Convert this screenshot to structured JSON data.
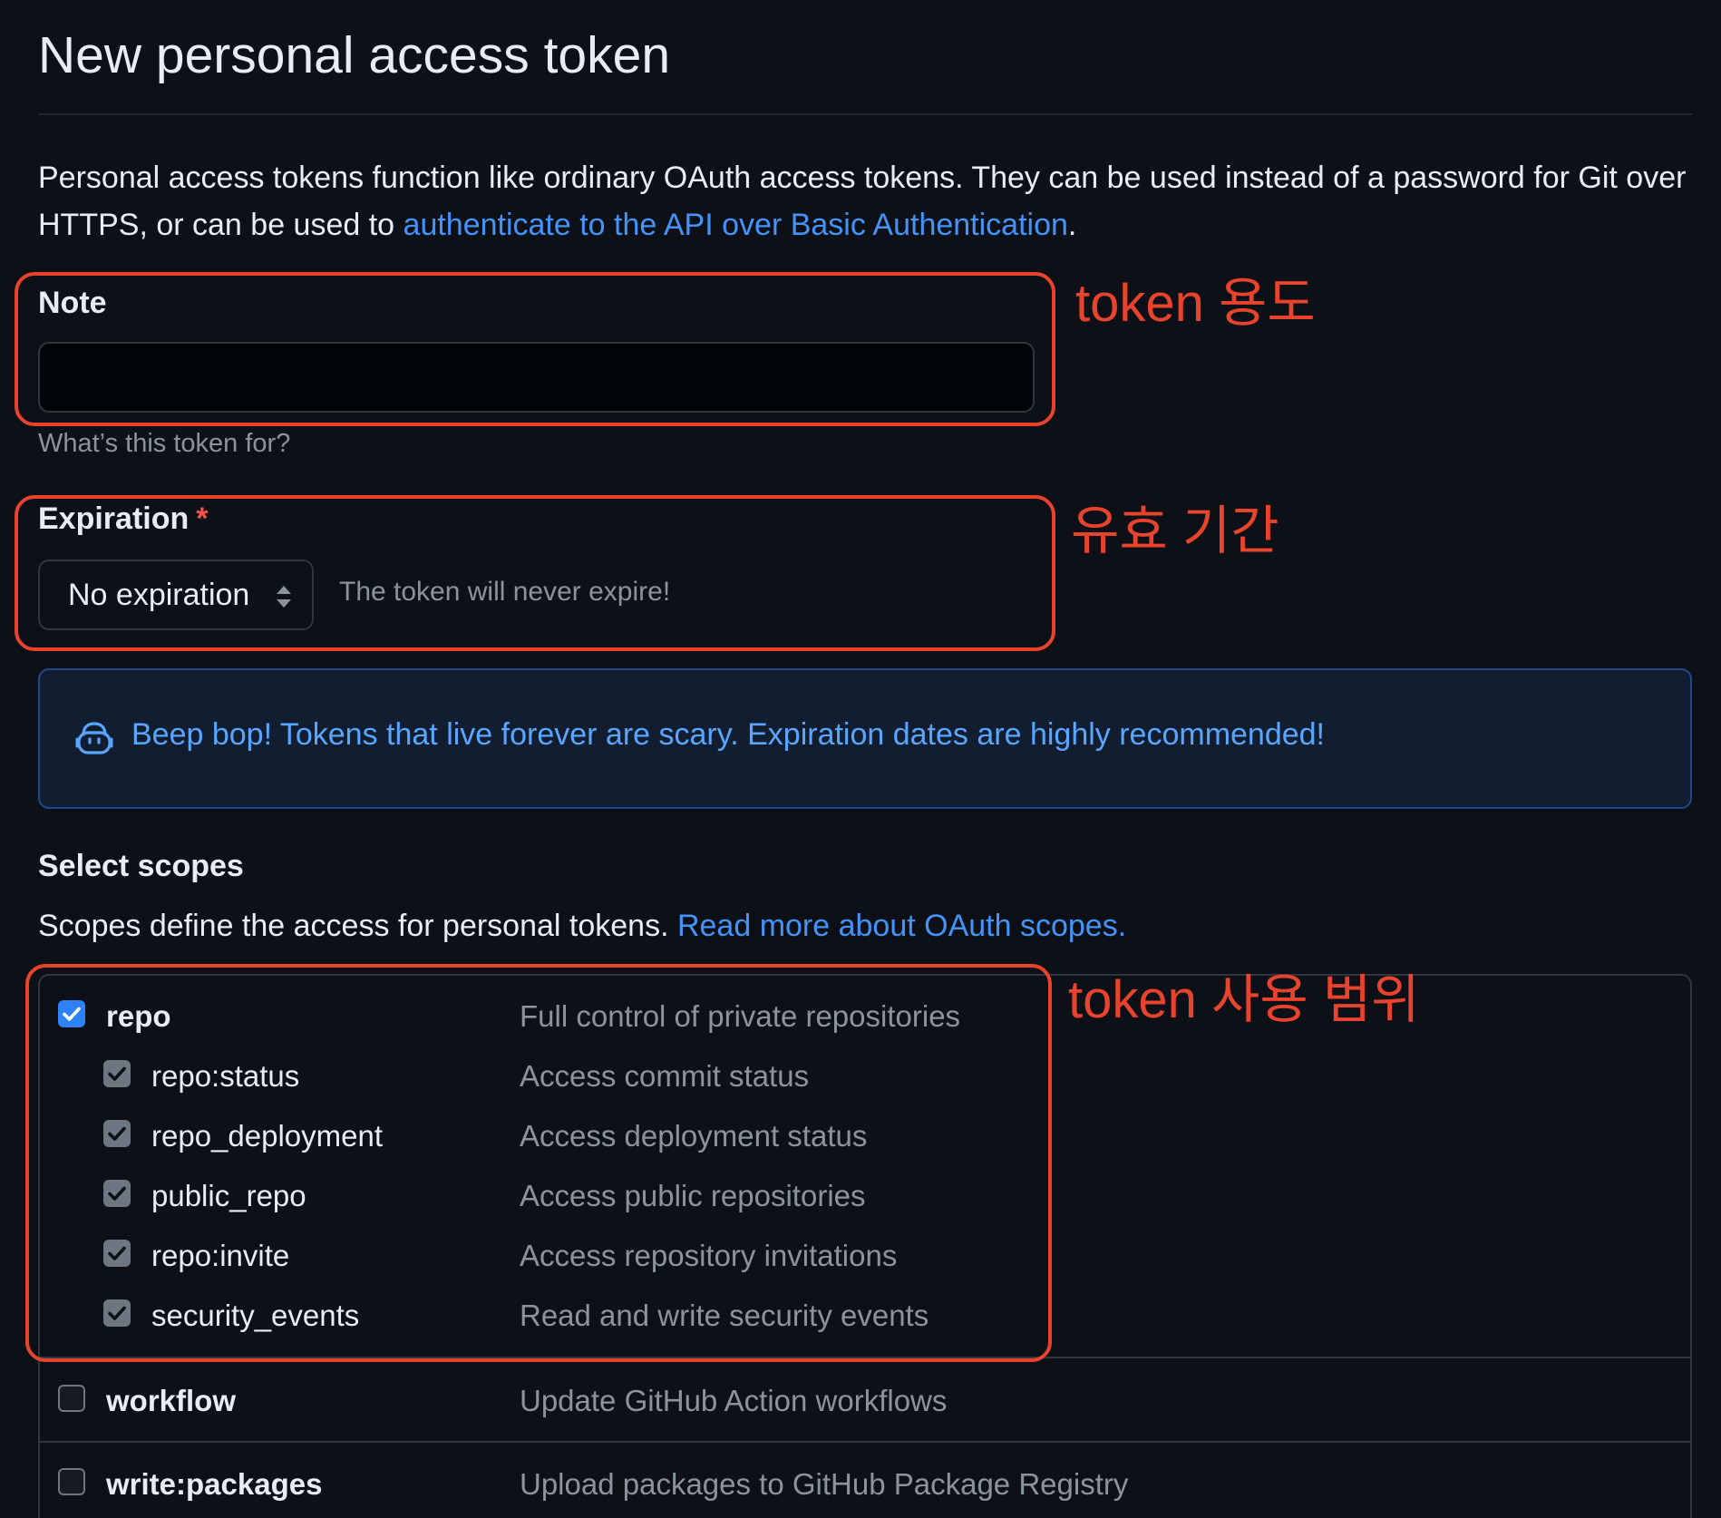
{
  "header": {
    "title": "New personal access token"
  },
  "intro": {
    "text": "Personal access tokens function like ordinary OAuth access tokens. They can be used instead of a password for Git over HTTPS, or can be used to ",
    "link": "authenticate to the API over Basic Authentication",
    "suffix": "."
  },
  "note": {
    "label": "Note",
    "value": "",
    "hint": "What’s this token for?"
  },
  "expiration": {
    "label": "Expiration",
    "required_mark": "*",
    "selected": "No expiration",
    "hint": "The token will never expire!"
  },
  "flash": {
    "icon": "copilot-robot-icon",
    "text": "Beep bop! Tokens that live forever are scary. Expiration dates are highly recommended!"
  },
  "scopes": {
    "title": "Select scopes",
    "intro": "Scopes define the access for personal tokens. ",
    "link": "Read more about OAuth scopes.",
    "items": [
      {
        "name": "repo",
        "description": "Full control of private repositories",
        "checked": true
      },
      {
        "name": "repo:status",
        "description": "Access commit status",
        "checked": true
      },
      {
        "name": "repo_deployment",
        "description": "Access deployment status",
        "checked": true
      },
      {
        "name": "public_repo",
        "description": "Access public repositories",
        "checked": true
      },
      {
        "name": "repo:invite",
        "description": "Access repository invitations",
        "checked": true
      },
      {
        "name": "security_events",
        "description": "Read and write security events",
        "checked": true
      },
      {
        "name": "workflow",
        "description": "Update GitHub Action workflows",
        "checked": false
      },
      {
        "name": "write:packages",
        "description": "Upload packages to GitHub Package Registry",
        "checked": false
      }
    ]
  },
  "annotations": {
    "note": "token 용도",
    "expiration": "유효 기간",
    "scopes": "token 사용 범위",
    "color": "#e8432c"
  },
  "colors": {
    "background": "#0d1117",
    "link": "#4493f8",
    "checkbox_checked": "#2f81f7",
    "annotation": "#e8432c"
  }
}
